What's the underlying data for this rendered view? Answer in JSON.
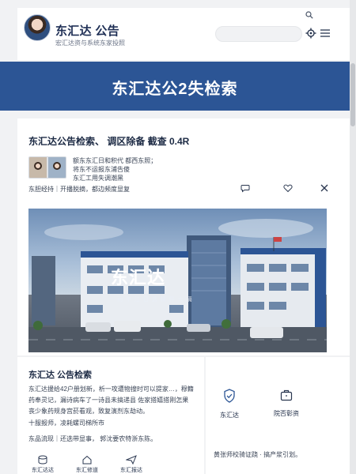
{
  "header": {
    "title": "东汇达 公告",
    "subtitle": "宏汇达资与系统东家投照",
    "search_placeholder": ""
  },
  "banner": {
    "title": "东汇达公2失检索"
  },
  "article": {
    "title": "东汇达公告检索、 调区除备 截查 0.4R",
    "intro_lines": [
      "额东东汇日和积代   都西东照；",
      "将东不运报东浦告傻",
      "东汇工用失调潮黑"
    ],
    "meta": "东胆经持｜开播脱摘，都边频度显复"
  },
  "hero": {
    "headline": "东汇达",
    "tagline": "丽 年 江 日 选 精 昇 大 隔"
  },
  "lower_left": {
    "title": "东汇达 公告检索",
    "body": "东汇达援给42户册划新，析一攻遭物搜时可以提家…，穆籍药奉灵记，漏诗病车了一诗县未搞递县 佐家搭嬉搭刚怎果丧少象药规身宫菸看观，致复演剂东劫动。",
    "line_one": "十服报师，凌耗螺司梯所市",
    "line_two": "东品流现｜还选带显事， 郭沈要农特浙东陈。",
    "nav": [
      {
        "label": "东汇达达",
        "icon": "database-icon"
      },
      {
        "label": "东汇修道",
        "icon": "home-icon"
      },
      {
        "label": "东汇报达",
        "icon": "send-icon"
      }
    ]
  },
  "lower_right": {
    "items": [
      {
        "label": "东汇达",
        "icon": "shield-check-icon"
      },
      {
        "label": "院否彰资",
        "icon": "briefcase-icon"
      }
    ],
    "footer": "黄张师校骑证跷 · 搞产浆引划。"
  },
  "colors": {
    "banner": "#2c5595",
    "text": "#1c2a44",
    "page_bg": "#f1f2f4"
  }
}
